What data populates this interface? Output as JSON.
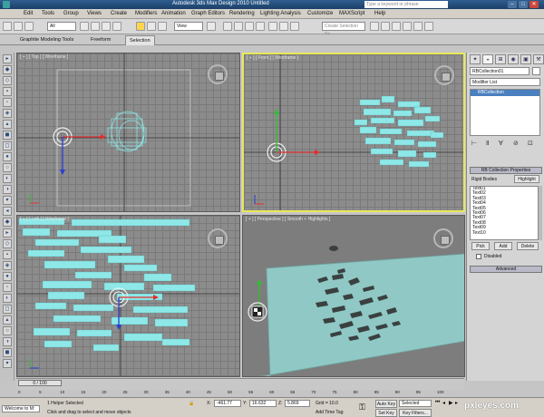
{
  "window": {
    "title": "Autodesk 3ds Max Design 2010      Untitled",
    "help_placeholder": "Type a keyword or phrase"
  },
  "menu": [
    "Edit",
    "Tools",
    "Group",
    "Views",
    "Create",
    "Modifiers",
    "Animation",
    "Graph Editors",
    "Rendering",
    "Lighting Analysis",
    "Customize",
    "MAXScript",
    "Help"
  ],
  "toolbar": {
    "filter_value": "All",
    "refcoord_value": "View",
    "named_sel_placeholder": "Create Selection Se"
  },
  "ribbon": {
    "tabs": [
      "Graphite Modeling Tools",
      "Freeform",
      "Selection"
    ],
    "active_tab": "Selection"
  },
  "viewports": {
    "top": "[ + ] [ Top ] [ Wireframe ]",
    "front": "[ + ] [ Front ] [ Wireframe ]",
    "left": "[ + ] [ Left ] [ Wireframe ]",
    "perspective": "[ + ] [ Perspective ] [ Smooth + Highlights ]"
  },
  "command_panel": {
    "object_name": "RBCollection01",
    "modifier_list": "Modifier List",
    "stack_item": "RBCollection",
    "rollout_title": "RB Collection Properties",
    "rigid_bodies_label": "Rigid Bodies",
    "highlight_label": "Highlight",
    "rigid_bodies": [
      "Text01",
      "Text02",
      "Text03",
      "Text04",
      "Text05",
      "Text06",
      "Text07",
      "Text08",
      "Text09",
      "Text10"
    ],
    "pick_label": "Pick",
    "add_label": "Add",
    "delete_label": "Delete",
    "disabled_label": "Disabled",
    "advanced_label": "Advanced"
  },
  "timeline": {
    "slider_label": "0 / 100",
    "ticks": [
      "0",
      "5",
      "10",
      "15",
      "20",
      "25",
      "30",
      "35",
      "40",
      "45",
      "50",
      "55",
      "60",
      "65",
      "70",
      "75",
      "80",
      "85",
      "90",
      "95",
      "100"
    ]
  },
  "status": {
    "welcome": "Welcome to M:",
    "selection_info": "1 Helper Selected",
    "prompt": "Click and drag to select and move objects",
    "x_label": "X:",
    "x_value": "-461.77",
    "y_label": "Y:",
    "y_value": "16.632",
    "z_label": "Z:",
    "z_value": "5.869",
    "grid": "Grid = 10.0",
    "add_time_tag": "Add Time Tag",
    "auto_key": "Auto Key",
    "selected": "Selected",
    "set_key": "Set Key",
    "key_filters": "Key Filters..."
  },
  "colors": {
    "viewport_bg": "#8c8c8c",
    "object": "#8ee8e8",
    "active_border": "#e8e85a",
    "title_bar": "#1c3f68"
  },
  "watermark": "pxleyes.com"
}
